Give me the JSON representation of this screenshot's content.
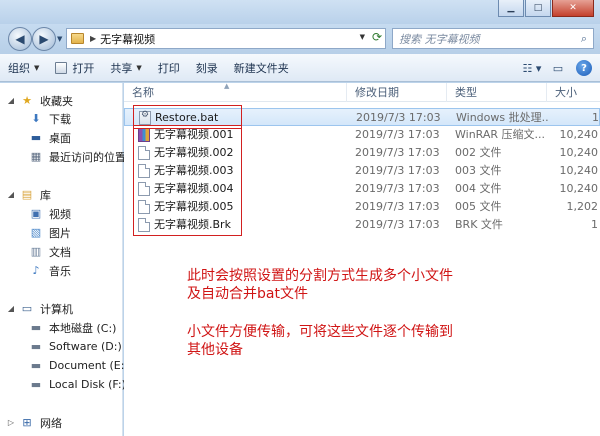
{
  "window": {
    "address": {
      "path": "无字幕视频"
    },
    "search": {
      "placeholder": "搜索 无字幕视频"
    }
  },
  "toolbar": {
    "organize": "组织",
    "open": "打开",
    "share": "共享",
    "print": "打印",
    "burn": "刻录",
    "new_folder": "新建文件夹"
  },
  "navpane": {
    "favorites": "收藏夹",
    "downloads": "下载",
    "desktop": "桌面",
    "recent": "最近访问的位置",
    "libraries": "库",
    "videos": "视频",
    "pictures": "图片",
    "documents": "文档",
    "music": "音乐",
    "computer": "计算机",
    "drive_c": "本地磁盘 (C:)",
    "drive_d": "Software (D:)",
    "drive_e": "Document (E:)",
    "drive_f": "Local Disk (F:)",
    "network": "网络"
  },
  "columns": {
    "name": "名称",
    "date": "修改日期",
    "type": "类型",
    "size": "大小"
  },
  "files": [
    {
      "name": "Restore.bat",
      "date": "2019/7/3 17:03",
      "type": "Windows 批处理...",
      "size": "1"
    },
    {
      "name": "无字幕视频.001",
      "date": "2019/7/3 17:03",
      "type": "WinRAR 压缩文...",
      "size": "10,240"
    },
    {
      "name": "无字幕视频.002",
      "date": "2019/7/3 17:03",
      "type": "002 文件",
      "size": "10,240"
    },
    {
      "name": "无字幕视频.003",
      "date": "2019/7/3 17:03",
      "type": "003 文件",
      "size": "10,240"
    },
    {
      "name": "无字幕视频.004",
      "date": "2019/7/3 17:03",
      "type": "004 文件",
      "size": "10,240"
    },
    {
      "name": "无字幕视频.005",
      "date": "2019/7/3 17:03",
      "type": "005 文件",
      "size": "1,202"
    },
    {
      "name": "无字幕视频.Brk",
      "date": "2019/7/3 17:03",
      "type": "BRK 文件",
      "size": "1"
    }
  ],
  "annotations": {
    "line1": "此时会按照设置的分割方式生成多个小文件",
    "line2": "及自动合并bat文件",
    "line3": "小文件方便传输，可将这些文件逐个传输到",
    "line4": "其他设备"
  },
  "colors": {
    "annotation": "#d01515",
    "selection": "#d4e7fa"
  }
}
